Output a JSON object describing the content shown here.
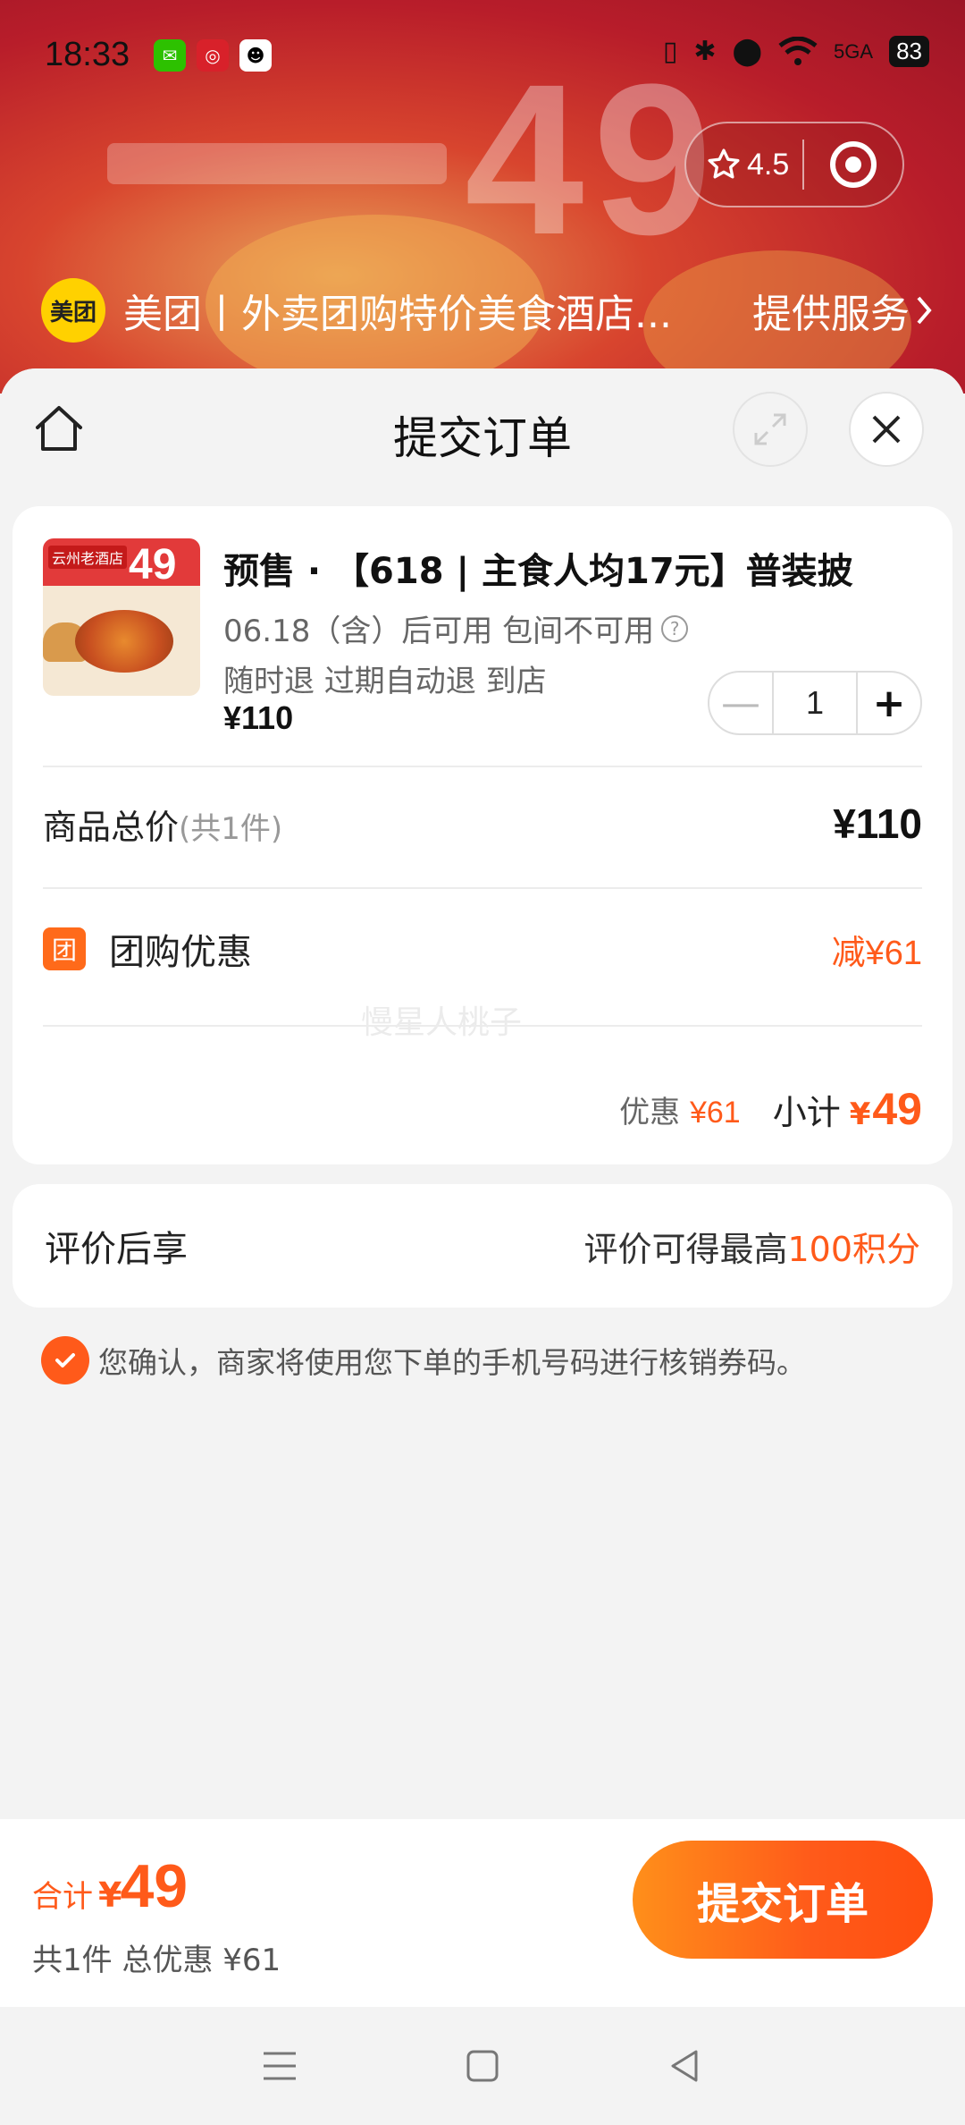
{
  "status_bar": {
    "time": "18:33",
    "battery": "83",
    "network": "5GA"
  },
  "capsule": {
    "rating": "4.5",
    "star_icon": "star-outline-icon",
    "target_icon": "target-icon"
  },
  "mini_program": {
    "logo_text": "美团",
    "name": "美团丨外卖团购特价美食酒店...",
    "service_label": "提供服务"
  },
  "sheet": {
    "title": "提交订单",
    "home_icon": "home-icon",
    "expand_icon": "expand-icon",
    "close_icon": "close-icon"
  },
  "product": {
    "image_tag": "云州老酒店",
    "image_number": "49",
    "title": "预售 · 【618 | 主食人均17元】普装披",
    "availability": "06.18（含）后可用 包间不可用",
    "refund_policy": "随时退 过期自动退 到店",
    "price": "¥110",
    "quantity": "1"
  },
  "summary": {
    "total_label": "商品总价",
    "total_count": "(共1件)",
    "total_value": "¥110",
    "discount_icon_text": "团",
    "discount_label": "团购优惠",
    "discount_value": "减¥61",
    "watermark": "慢星人桃子",
    "sub_discount_label": "优惠",
    "sub_discount_value": "¥61",
    "subtotal_label": "小计",
    "subtotal_currency": "¥",
    "subtotal_value": "49"
  },
  "review": {
    "label": "评价后享",
    "reward_prefix": "评价可得最高",
    "reward_points": "100积分"
  },
  "consent": {
    "text": "您确认，商家将使用您下单的手机号码进行核销券码。",
    "checked": true
  },
  "bottom_bar": {
    "total_label": "合计",
    "total_currency": "¥",
    "total_value": "49",
    "summary_text": "共1件 总优惠 ¥61",
    "submit_label": "提交订单"
  },
  "colors": {
    "accent": "#ff5a1a",
    "brand_yellow": "#ffd100"
  }
}
